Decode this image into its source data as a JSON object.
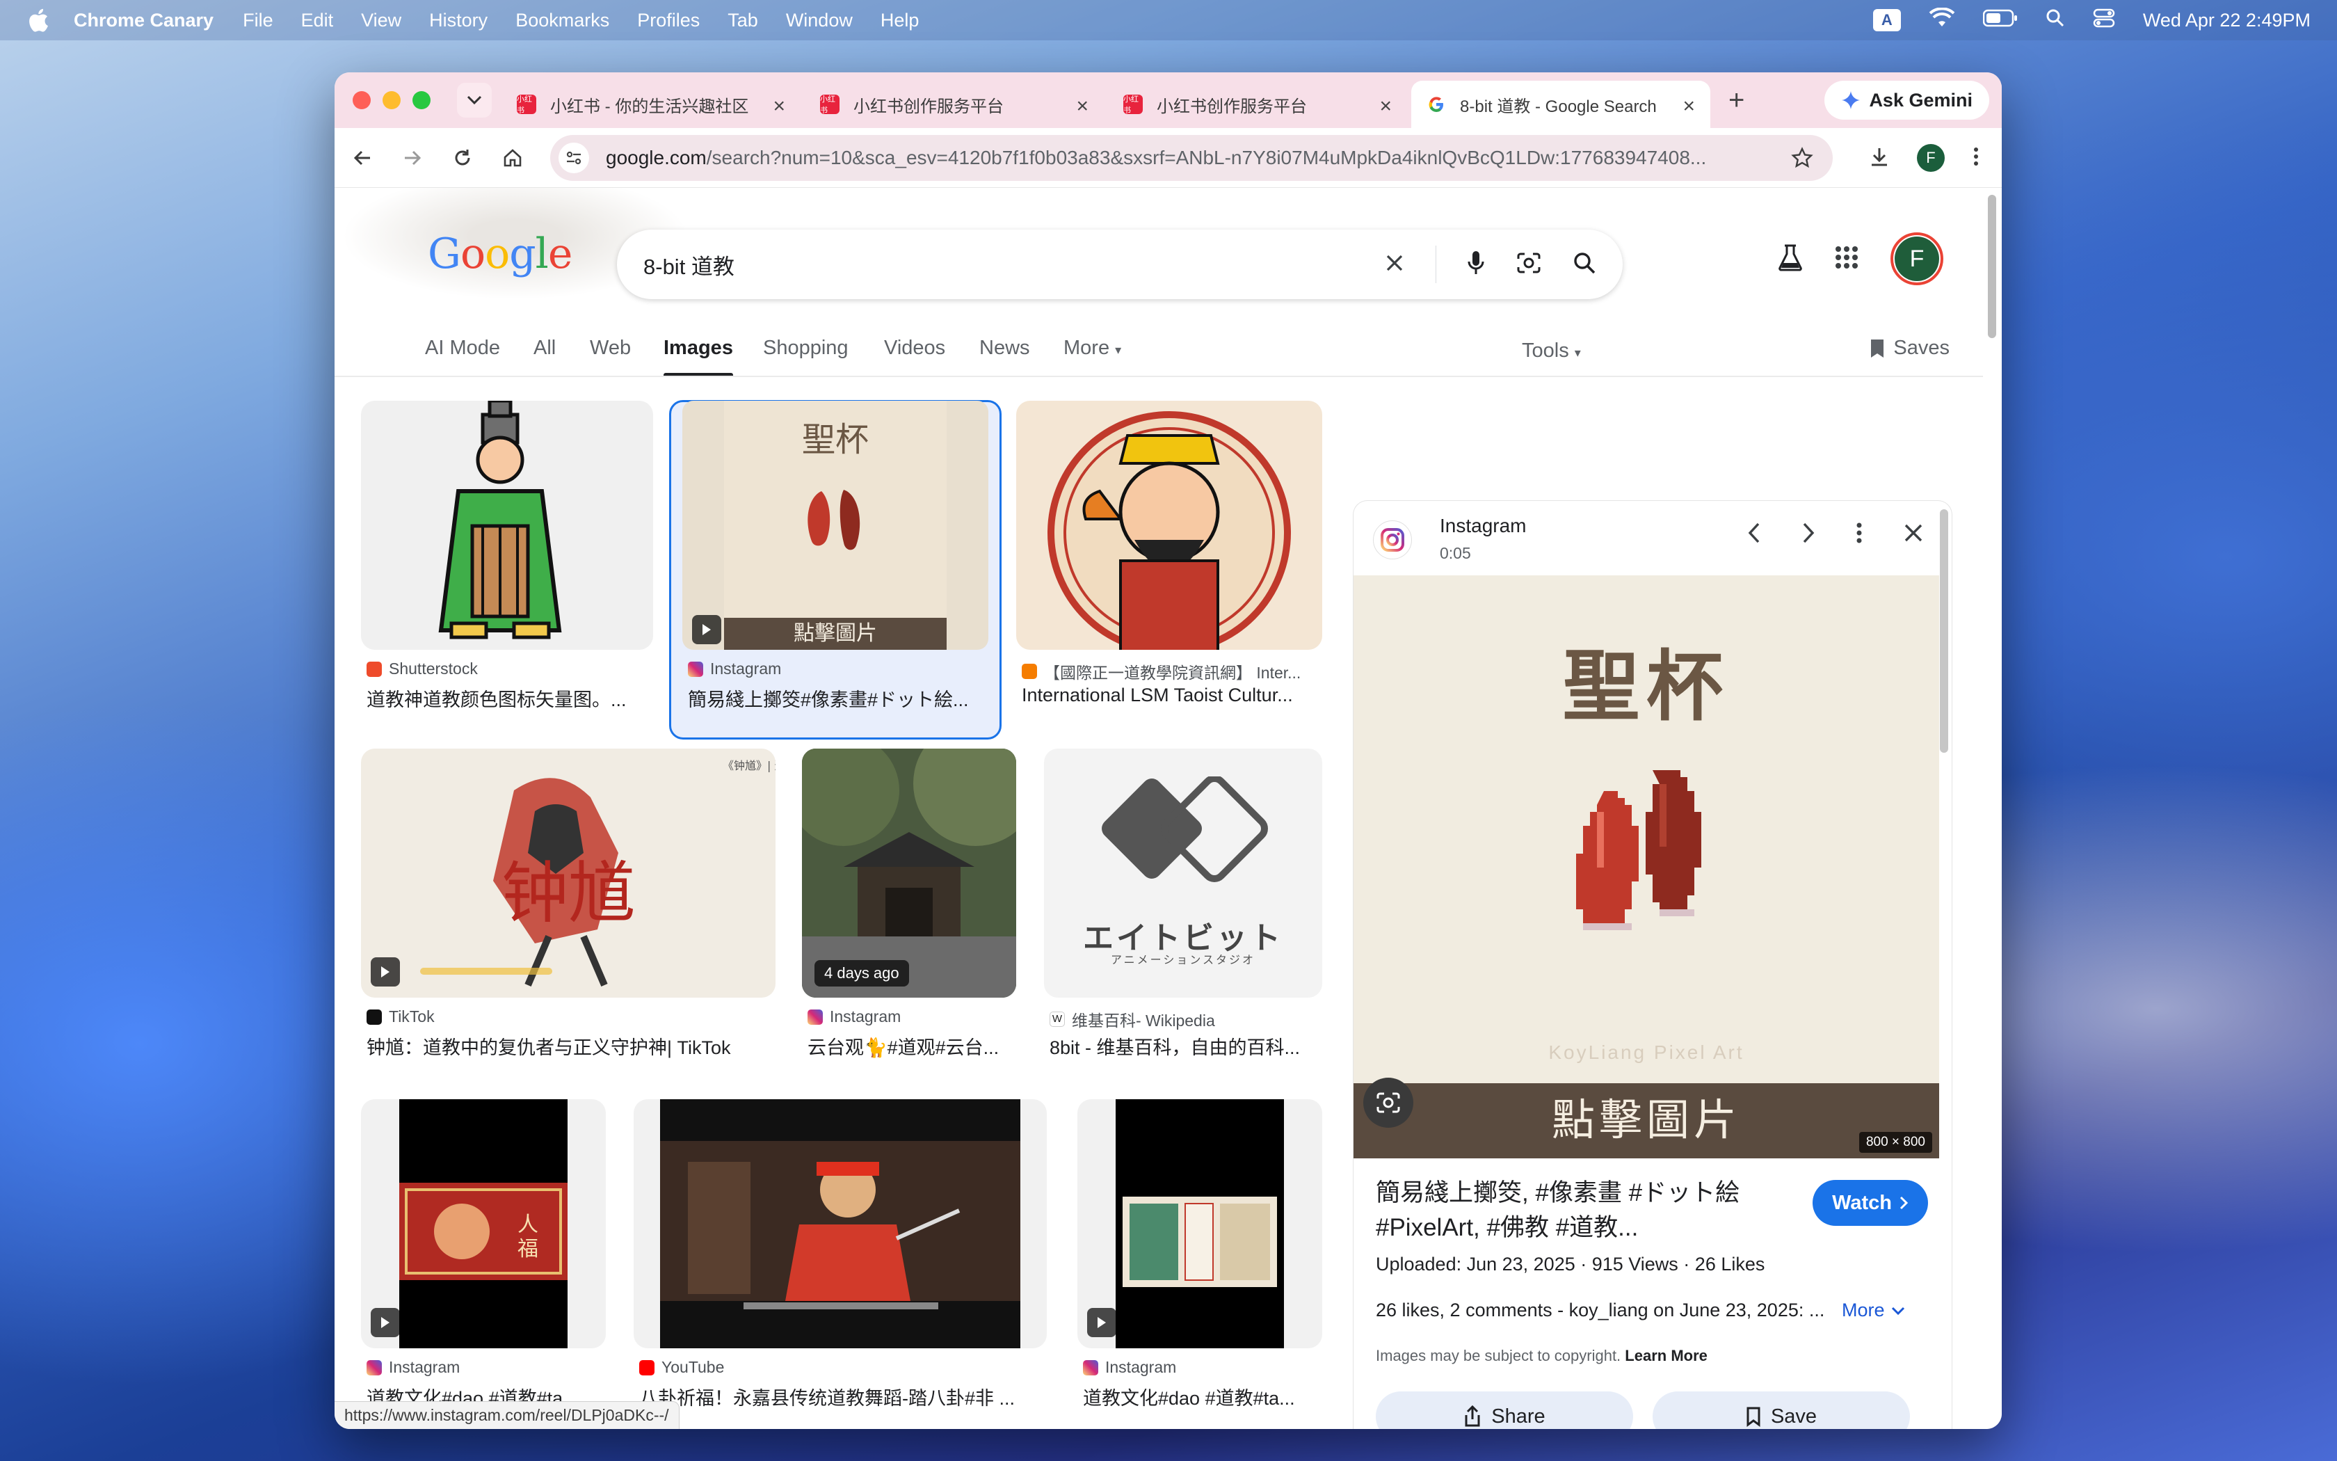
{
  "menubar": {
    "app": "Chrome Canary",
    "items": [
      "File",
      "Edit",
      "View",
      "History",
      "Bookmarks",
      "Profiles",
      "Tab",
      "Window",
      "Help"
    ],
    "input_source": "A",
    "datetime": "Wed Apr 22  2:49PM"
  },
  "tabs": [
    {
      "title": "小红书 - 你的生活兴趣社区",
      "favicon": "xiaohongshu"
    },
    {
      "title": "小红书创作服务平台",
      "favicon": "xiaohongshu"
    },
    {
      "title": "小红书创作服务平台",
      "favicon": "xiaohongshu"
    },
    {
      "title": "8-bit 道教 - Google Search",
      "favicon": "google"
    }
  ],
  "ask_gemini": "Ask Gemini",
  "address": {
    "domain": "google.com",
    "path": "/search?num=10&sca_esv=4120b7f1f0b03a83&sxsrf=ANbL-n7Y8i07M4uMpkDa4iknlQvBcQ1LDw:177683947408..."
  },
  "profile_initial": "F",
  "google": {
    "logo": "Google",
    "query": "8-bit 道教",
    "account_initial": "F",
    "nav": [
      "AI Mode",
      "All",
      "Web",
      "Images",
      "Shopping",
      "Videos",
      "News",
      "More"
    ],
    "tools": "Tools",
    "saves": "Saves"
  },
  "results": [
    {
      "source": "Shutterstock",
      "title": "道教神道教颜色图标矢量图。...",
      "video": false
    },
    {
      "source": "Instagram",
      "title": "簡易綫上擲筊#像素畫#ドット絵...",
      "video": true,
      "overlay": "點擊圖片",
      "seal": "聖杯"
    },
    {
      "source": "【國際正一道教學院資訊網】 Inter...",
      "title": "International LSM Taoist Cultur...",
      "video": false
    },
    {
      "source": "TikTok",
      "title": "钟馗：道教中的复仇者与正义守护神| TikTok",
      "video": true,
      "art": "钟馗"
    },
    {
      "source": "Instagram",
      "title": "云台观🐈#道观#云台...",
      "video": false,
      "badge": "4 days ago"
    },
    {
      "source": "维基百科- Wikipedia",
      "title": "8bit - 维基百科，自由的百科...",
      "video": false,
      "logo_text": "エイトビット",
      "logo_sub": "アニメーションスタジオ"
    },
    {
      "source": "Instagram",
      "title": "道教文化#dao #道教#ta...",
      "video": true
    },
    {
      "source": "YouTube",
      "title": "八卦祈福！永嘉县传统道教舞蹈-踏八卦#非 ...",
      "video": false
    },
    {
      "source": "Instagram",
      "title": "道教文化#dao #道教#ta...",
      "video": true
    }
  ],
  "panel": {
    "source": "Instagram",
    "duration": "0:05",
    "image_title": "聖杯",
    "image_caption": "點擊圖片",
    "watermark": "KoyLiang Pixel Art",
    "resolution": "800 × 800",
    "title": "簡易綫上擲筊, #像素畫 #ドット絵 #PixelArt, #佛教 #道教...",
    "watch": "Watch",
    "meta": "Uploaded: Jun 23, 2025  ·  915 Views  ·  26 Likes",
    "description": "26 likes, 2 comments - koy_liang on June 23, 2025: ...",
    "more": "More",
    "copyright": "Images may be subject to copyright.",
    "learn_more": "Learn More",
    "share": "Share",
    "save": "Save"
  },
  "status_url": "https://www.instagram.com/reel/DLPj0aDKc--/"
}
